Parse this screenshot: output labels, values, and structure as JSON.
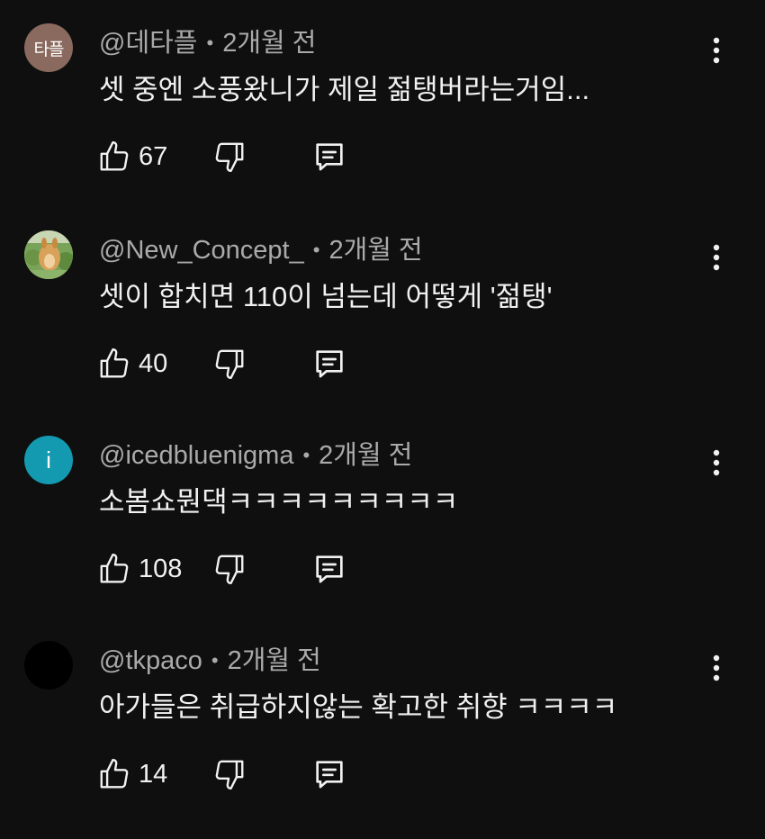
{
  "comments": [
    {
      "handle": "@데타플",
      "time": "2개월 전",
      "text": "셋 중엔 소풍왔니가 제일 젊탱버라는거임...",
      "likes": "67",
      "avatar_text": "타플",
      "avatar_color": "#8a6a5e"
    },
    {
      "handle": "@New_Concept_",
      "time": "2개월 전",
      "text": "셋이 합치면 110이 넘는데 어떻게 '젊탱'",
      "likes": "40",
      "avatar_text": "",
      "avatar_color": "#7aa35a"
    },
    {
      "handle": "@icedbluenigma",
      "time": "2개월 전",
      "text": "소봄쇼뭔댁ㅋㅋㅋㅋㅋㅋㅋㅋㅋ",
      "likes": "108",
      "avatar_text": "i",
      "avatar_color": "#139ab0"
    },
    {
      "handle": "@tkpaco",
      "time": "2개월 전",
      "text": "아가들은 취급하지않는 확고한 취향 ㅋㅋㅋㅋ",
      "likes": "14",
      "avatar_text": "",
      "avatar_color": "#000000"
    }
  ],
  "meta_separator": "•",
  "icons": {
    "like": "thumbs-up-icon",
    "dislike": "thumbs-down-icon",
    "reply": "reply-icon",
    "more": "more-vertical-icon"
  }
}
